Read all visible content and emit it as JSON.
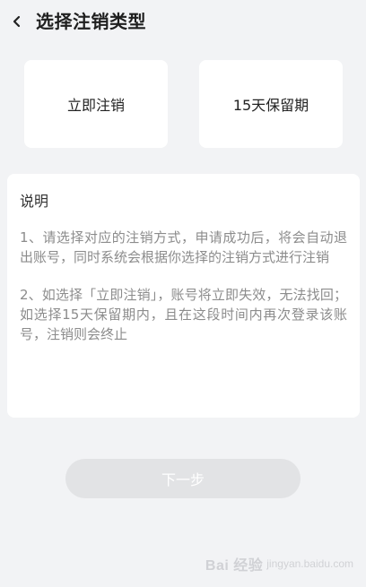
{
  "header": {
    "title": "选择注销类型",
    "back_icon": "chevron-left-icon"
  },
  "options": [
    {
      "label": "立即注销"
    },
    {
      "label": "15天保留期"
    }
  ],
  "info": {
    "title": "说明",
    "paragraphs": [
      "1、请选择对应的注销方式，申请成功后，将会自动退出账号，同时系统会根据你选择的注销方式进行注销",
      "2、如选择「立即注销」，账号将立即失效，无法找回；如选择15天保留期内，且在这段时间内再次登录该账号，注销则会终止"
    ]
  },
  "next_button": {
    "label": "下一步"
  },
  "watermark": {
    "text": "Bai 经验",
    "sub": "jingyan.baidu.com"
  }
}
